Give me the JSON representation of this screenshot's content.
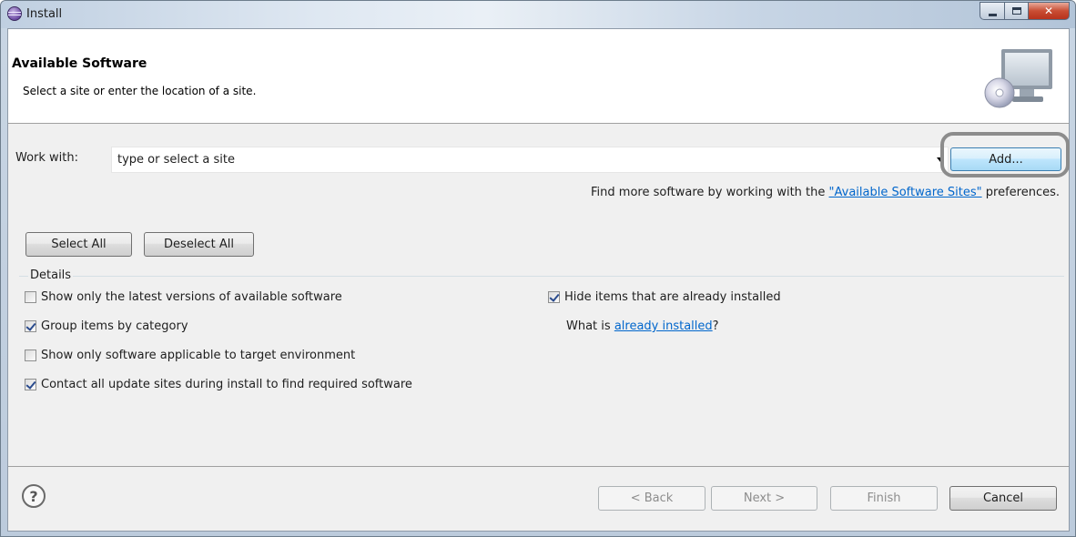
{
  "window": {
    "title": "Install"
  },
  "header": {
    "title": "Available Software",
    "description": "Select a site or enter the location of a site."
  },
  "work_with": {
    "label": "Work with:",
    "value": "type or select a site",
    "add_button": "Add..."
  },
  "find_more": {
    "prefix": "Find more software by working with the ",
    "link": "\"Available Software Sites\"",
    "suffix": " preferences."
  },
  "selection_buttons": {
    "select_all": "Select All",
    "deselect_all": "Deselect All"
  },
  "details": {
    "legend": "Details",
    "left_options": [
      {
        "label": "Show only the latest versions of available software",
        "checked": false
      },
      {
        "label": "Group items by category",
        "checked": true
      },
      {
        "label": "Show only software applicable to target environment",
        "checked": false
      },
      {
        "label": "Contact all update sites during install to find required software",
        "checked": true
      }
    ],
    "hide_installed": {
      "label": "Hide items that are already installed",
      "checked": true
    },
    "what_is": {
      "prefix": "What is ",
      "link": "already installed",
      "suffix": "?"
    }
  },
  "footer": {
    "help_symbol": "?",
    "back": "< Back",
    "next": "Next >",
    "finish": "Finish",
    "cancel": "Cancel"
  },
  "colors": {
    "link": "#0066cc",
    "add_button_focus": "#3c7fb1",
    "callout_outline": "#8c8c8c"
  },
  "icons": [
    "install-app-icon",
    "computer-cd-banner-icon",
    "dropdown-arrow-icon",
    "help-icon"
  ]
}
